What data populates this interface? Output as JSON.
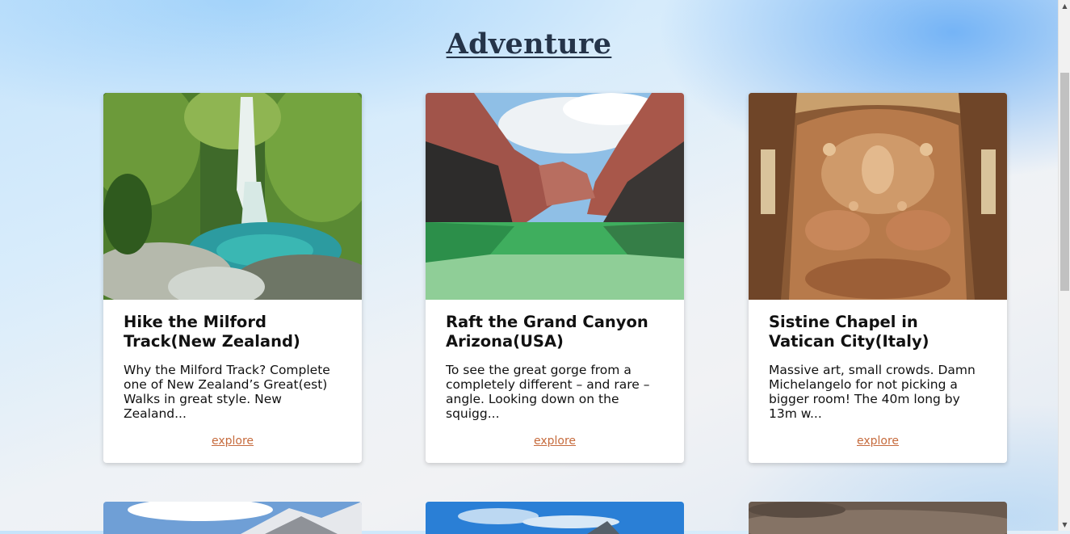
{
  "page": {
    "heading": "Adventure"
  },
  "cards": [
    {
      "title": "Hike the Milford Track(New Zealand)",
      "description": "Why the Milford Track? Complete one of New Zealand’s Great(est) Walks in great style. New Zealand...",
      "link": "explore"
    },
    {
      "title": "Raft the Grand Canyon Arizona(USA)",
      "description": "To see the great gorge from a completely different – and rare – angle. Looking down on the squigg...",
      "link": "explore"
    },
    {
      "title": "Sistine Chapel in Vatican City(Italy)",
      "description": "Massive art, small crowds. Damn Michelangelo for not picking a bigger room! The 40m long by 13m w...",
      "link": "explore"
    }
  ],
  "colors": {
    "link": "#c66b3d",
    "heading": "#253449"
  },
  "icons": {
    "scroll_up": "triangle-up-icon",
    "scroll_down": "triangle-down-icon"
  }
}
